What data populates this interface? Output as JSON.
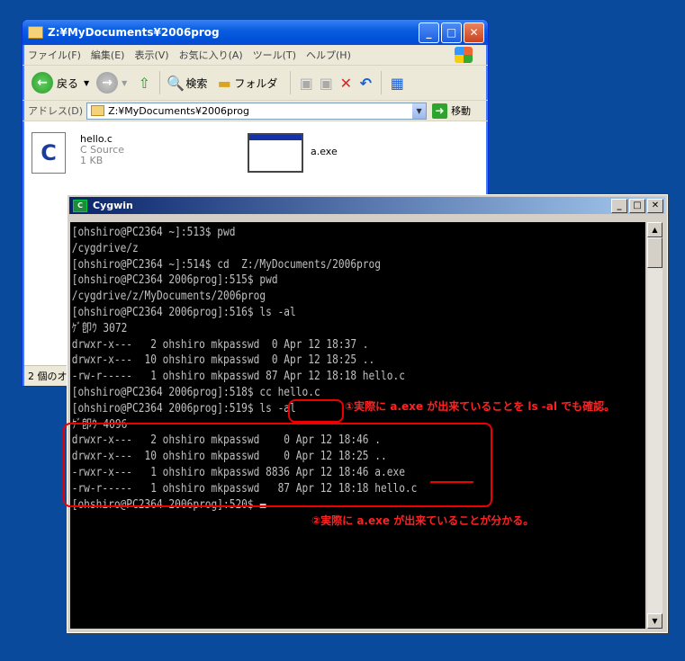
{
  "explorer": {
    "title": "Z:¥MyDocuments¥2006prog",
    "menu": [
      "ファイル(F)",
      "編集(E)",
      "表示(V)",
      "お気に入り(A)",
      "ツール(T)",
      "ヘルプ(H)"
    ],
    "toolbar": {
      "back": "戻る",
      "search": "検索",
      "folders": "フォルダ"
    },
    "address_label": "アドレス(D)",
    "address_value": "Z:¥MyDocuments¥2006prog",
    "go": "移動",
    "files": [
      {
        "name": "hello.c",
        "type": "C Source",
        "size": "1 KB"
      },
      {
        "name": "a.exe"
      }
    ],
    "status": "2 個のオ"
  },
  "cygwin": {
    "title": "Cygwin",
    "lines": [
      "[ohshiro@PC2364 ~]:513$ pwd",
      "/cygdrive/z",
      "[ohshiro@PC2364 ~]:514$ cd  Z:/MyDocuments/2006prog",
      "[ohshiro@PC2364 2006prog]:515$ pwd",
      "/cygdrive/z/MyDocuments/2006prog",
      "[ohshiro@PC2364 2006prog]:516$ ls -al",
      "ｹﾞ卽ｳ 3072",
      "drwxr-x---   2 ohshiro mkpasswd  0 Apr 12 18:37 .",
      "drwxr-x---  10 ohshiro mkpasswd  0 Apr 12 18:25 ..",
      "-rw-r-----   1 ohshiro mkpasswd 87 Apr 12 18:18 hello.c",
      "[ohshiro@PC2364 2006prog]:518$ cc hello.c",
      "[ohshiro@PC2364 2006prog]:519$ ls -al",
      "ｹﾞ卽ｳ 4096",
      "drwxr-x---   2 ohshiro mkpasswd    0 Apr 12 18:46 .",
      "drwxr-x---  10 ohshiro mkpasswd    0 Apr 12 18:25 ..",
      "-rwxr-x---   1 ohshiro mkpasswd 8836 Apr 12 18:46 a.exe",
      "-rw-r-----   1 ohshiro mkpasswd   87 Apr 12 18:18 hello.c",
      "[ohshiro@PC2364 2006prog]:520$ "
    ]
  },
  "annotations": {
    "note1": "①実際に a.exe が出来ていることを ls -al でも確認。",
    "note2": "②実際に a.exe が出来ていることが分かる。"
  },
  "colors": {
    "annotation": "#ff2222",
    "terminal_bg": "#000000",
    "terminal_fg": "#c0c0c0",
    "desktop": "#0a4a9c"
  }
}
